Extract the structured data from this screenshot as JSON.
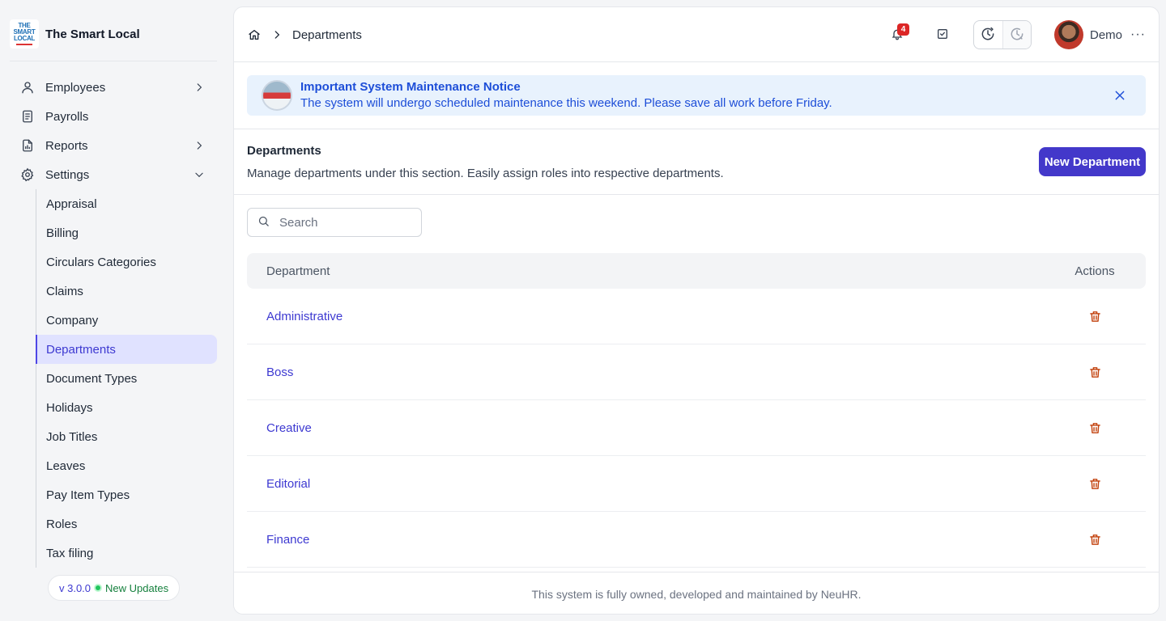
{
  "brand": {
    "logo_lines": [
      "THE",
      "SMART",
      "LOCAL"
    ],
    "name": "The Smart Local"
  },
  "sidebar": {
    "items": [
      {
        "label": "Employees",
        "icon": "user-icon",
        "chevron": "right"
      },
      {
        "label": "Payrolls",
        "icon": "receipt-icon"
      },
      {
        "label": "Reports",
        "icon": "report-icon",
        "chevron": "right"
      },
      {
        "label": "Settings",
        "icon": "gear-icon",
        "chevron": "down"
      }
    ],
    "settings_items": [
      "Appraisal",
      "Billing",
      "Circulars Categories",
      "Claims",
      "Company",
      "Departments",
      "Document Types",
      "Holidays",
      "Job Titles",
      "Leaves",
      "Pay Item Types",
      "Roles",
      "Tax filing"
    ],
    "active_settings_item": "Departments",
    "version": "v 3.0.0",
    "updates_label": "New Updates"
  },
  "header": {
    "breadcrumb": "Departments",
    "notification_count": "4",
    "user_name": "Demo",
    "more_label": "···"
  },
  "notice": {
    "title": "Important System Maintenance Notice",
    "message": "The system will undergo scheduled maintenance this weekend. Please save all work before Friday."
  },
  "section": {
    "title": "Departments",
    "description": "Manage departments under this section. Easily assign roles into respective departments.",
    "new_button": "New Department"
  },
  "search": {
    "placeholder": "Search",
    "value": ""
  },
  "table": {
    "columns": [
      "Department",
      "Actions"
    ],
    "rows": [
      "Administrative",
      "Boss",
      "Creative",
      "Editorial",
      "Finance"
    ]
  },
  "footer": {
    "text": "This system is fully owned, developed and maintained by NeuHR."
  },
  "colors": {
    "accent": "#4338ca",
    "link": "#3d39d1",
    "danger": "#c2410c",
    "notice_bg": "#e8f2fd",
    "notice_text": "#1d4ed8"
  }
}
